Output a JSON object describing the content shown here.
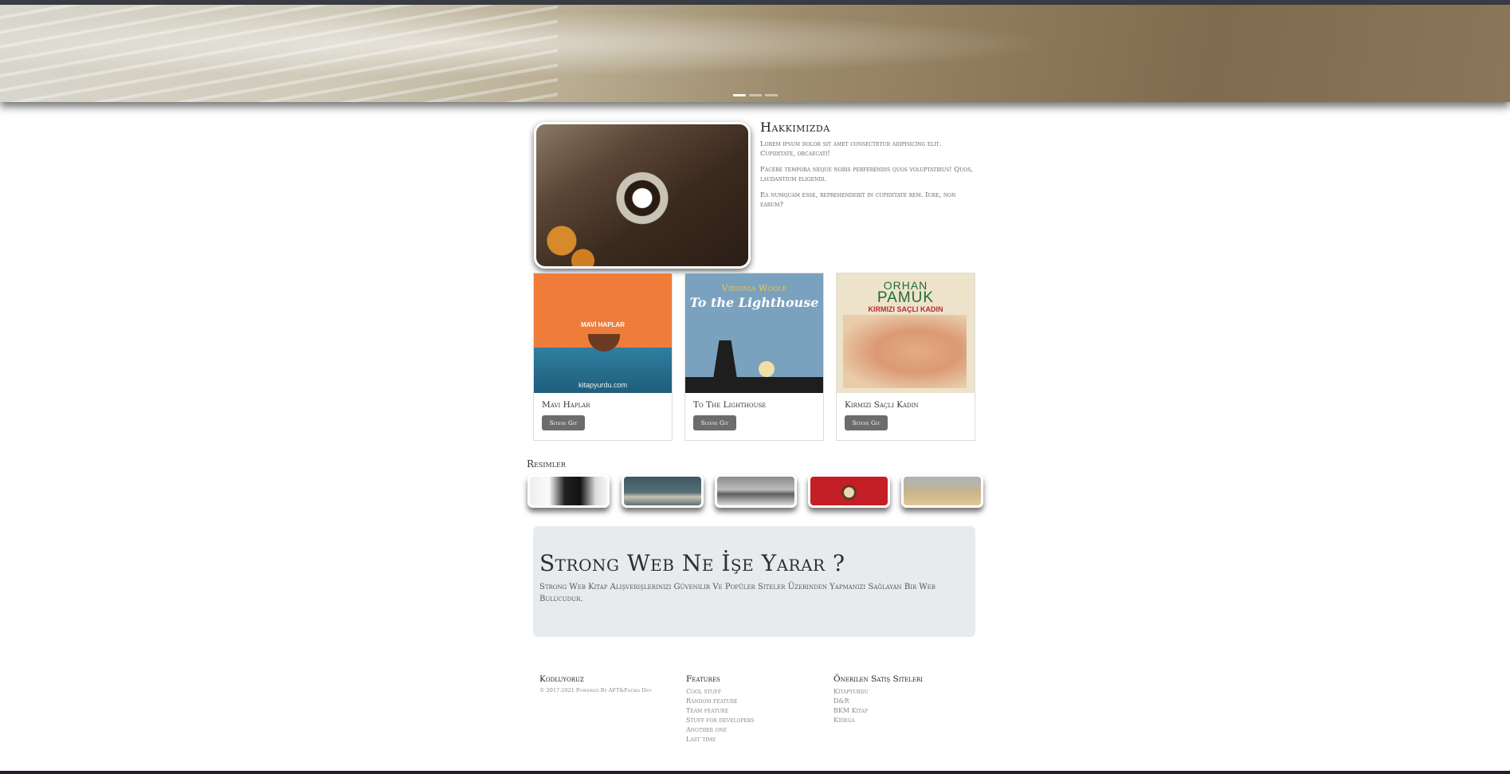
{
  "about": {
    "title": "Hakkimizda",
    "paragraphs": [
      "Lorem ipsum dolor sit amet consectetur adipisicing elit. Cupiditate, obcaecati!",
      "Facere tempora neque nobis perferendis quos voluptatibus! Quos, laudantium eligendi.",
      "Ea numquam esse, reprehenderit in cupiditate rem. Iure, non earum?"
    ]
  },
  "books": [
    {
      "name": "Mavi Haplar",
      "button": "Siteye Git",
      "cover_title": "MAVİ HAPLAR",
      "cover_site": "kitapyurdu.com"
    },
    {
      "name": "To The Lighthouse",
      "button": "Siteye Git",
      "cover_author": "Virginia Woolf",
      "cover_title": "To the Lighthouse"
    },
    {
      "name": "Kirmizi Saçli Kadin",
      "button": "Siteye Git",
      "cover_author_1": "ORHAN",
      "cover_author_2": "PAMUK",
      "cover_title": "KIRMIZI SAÇLI KADIN"
    }
  ],
  "gallery": {
    "title": "Resimler"
  },
  "jumbotron": {
    "title": "Strong Web Ne İşe Yarar ?",
    "text": "Strong Web Kitap Alişverişlerinizi Güvenilir Ve Popüler Siteler Üzerinden Yapmanizi Sağlayan Bir Web Bulucudur."
  },
  "footer": {
    "brand": {
      "title": "Kodluyoruz",
      "copyright": "© 2017-2021 Powered By AFT&Patika Dev"
    },
    "features": {
      "title": "Features",
      "items": [
        "Cool stuff",
        "Random feature",
        "Team feature",
        "Stuff for developers",
        "Another one",
        "Last time"
      ]
    },
    "sites": {
      "title": "Önerilen Satiş Siteleri",
      "items": [
        "Kitapyurdu",
        "D&R",
        "BKM Kitap",
        "Kidega"
      ]
    }
  },
  "colors": {
    "button": "#6c6c6c",
    "jumbotron_bg": "#e8ebee",
    "footer_bar": "#2b1a33"
  }
}
